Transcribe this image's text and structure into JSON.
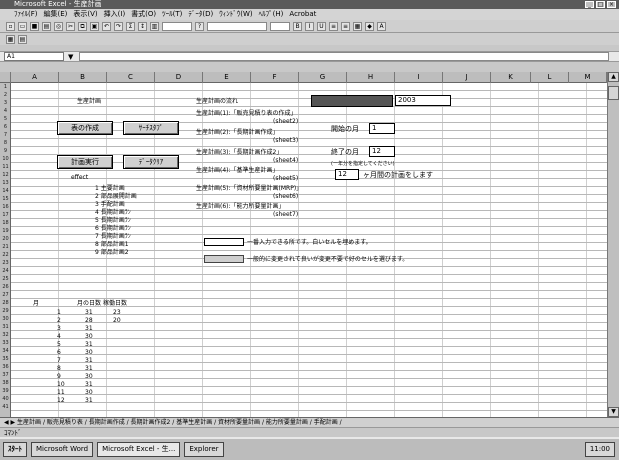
{
  "window": {
    "title": "Microsoft Excel - 生産計画",
    "controls": [
      "_",
      "□",
      "×"
    ]
  },
  "menu": [
    "ﾌｧｲﾙ(F)",
    "編集(E)",
    "表示(V)",
    "挿入(I)",
    "書式(O)",
    "ﾂｰﾙ(T)",
    "ﾃﾞｰﾀ(D)",
    "ｳｨﾝﾄﾞｳ(W)",
    "ﾍﾙﾌﾟ(H)",
    "Acrobat"
  ],
  "formula": {
    "namebox": "A1"
  },
  "columns": [
    "A",
    "B",
    "C",
    "D",
    "E",
    "F",
    "G",
    "H",
    "I",
    "J",
    "K",
    "L",
    "M"
  ],
  "sheet": {
    "title_left": "生産計画",
    "title_right": "生産計画の流れ",
    "year_value": "2003",
    "buttons": {
      "b1": "表の作成",
      "b2": "ｻｰﾁｽﾀﾌﾟ",
      "b3": "計画実行",
      "b4": "ﾃﾞｰﾀｸﾘｱ"
    },
    "effect_label": "effect",
    "list_items": [
      "1 主要計画",
      "2 部品展開計画",
      "3 手配計画",
      "4 長期計画ﾗﾝ",
      "5 長期計画ﾗﾝ",
      "6 長期計画ﾗﾝ",
      "7 長期計画ﾗﾝ",
      "8 部品計画1",
      "9 部品計画2"
    ],
    "flow": [
      {
        "label": "生産計画(1):「販売見積り表の作成」",
        "sub": "(sheet2)"
      },
      {
        "label": "生産計画(2):「長期計画作成」",
        "sub": "(sheet3)"
      },
      {
        "label": "生産計画(3):「長期計画作成2」",
        "sub": "(sheet4)"
      },
      {
        "label": "生産計画(4):「基準生産計画」",
        "sub": "(sheet5)"
      },
      {
        "label": "生産計画(5):「資材所要量計画(MRP)」",
        "sub": "(sheet6)"
      },
      {
        "label": "生産計画(6):「能力所要量計画」",
        "sub": "(sheet7)"
      }
    ],
    "start_month_label": "開始の月",
    "start_month_value": "1",
    "end_month_label": "終了の月",
    "end_month_value": "12",
    "end_note": "(一年分を指定してください)",
    "months_value": "12",
    "months_suffix": "ヶ月間の計画をします",
    "legend1": "一番入力できる所です。白いセルを埋めます。",
    "legend2": "一般的に変更されて良いが変更不要で好のセルを選びます。",
    "table_headers": [
      "月",
      "月の日数",
      "稼働日数"
    ],
    "table_rows": [
      [
        "1",
        "31",
        "23"
      ],
      [
        "2",
        "28",
        "20"
      ],
      [
        "3",
        "31",
        ""
      ],
      [
        "4",
        "30",
        ""
      ],
      [
        "5",
        "31",
        ""
      ],
      [
        "6",
        "30",
        ""
      ],
      [
        "7",
        "31",
        ""
      ],
      [
        "8",
        "31",
        ""
      ],
      [
        "9",
        "30",
        ""
      ],
      [
        "10",
        "31",
        ""
      ],
      [
        "11",
        "30",
        ""
      ],
      [
        "12",
        "31",
        ""
      ]
    ]
  },
  "tabs": "生産計画 / 販売見積り表 / 長期計画作成 / 長期計画作成2 / 基準生産計画 / 資材所要量計画 / 能力所要量計画 / 手配計画 /",
  "status": "ｺﾏﾝﾄﾞ",
  "taskbar": {
    "start": "ｽﾀｰﾄ",
    "items": [
      "Microsoft Word",
      "Microsoft Excel - 生...",
      "Explorer"
    ],
    "clock": "11:00"
  }
}
